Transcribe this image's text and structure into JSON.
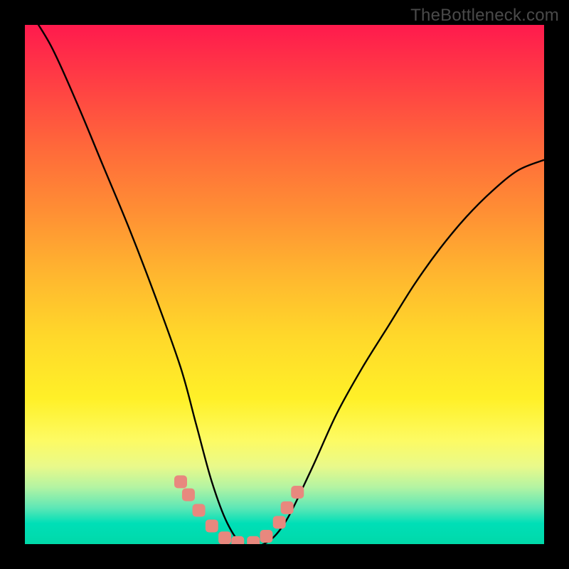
{
  "watermark": "TheBottleneck.com",
  "chart_data": {
    "type": "line",
    "title": "",
    "xlabel": "",
    "ylabel": "",
    "x": [
      0.0,
      0.05,
      0.1,
      0.15,
      0.2,
      0.25,
      0.3,
      0.33,
      0.36,
      0.39,
      0.42,
      0.46,
      0.5,
      0.55,
      0.6,
      0.65,
      0.7,
      0.75,
      0.8,
      0.85,
      0.9,
      0.95,
      1.0
    ],
    "values": [
      1.04,
      0.96,
      0.85,
      0.73,
      0.61,
      0.48,
      0.34,
      0.23,
      0.12,
      0.04,
      0.0,
      0.0,
      0.04,
      0.14,
      0.25,
      0.34,
      0.42,
      0.5,
      0.57,
      0.63,
      0.68,
      0.72,
      0.74
    ],
    "xlim": [
      0,
      1
    ],
    "ylim": [
      0,
      1
    ],
    "markers": {
      "color": "#e8887e",
      "points": [
        {
          "x": 0.3,
          "y": 0.12
        },
        {
          "x": 0.315,
          "y": 0.095
        },
        {
          "x": 0.335,
          "y": 0.065
        },
        {
          "x": 0.36,
          "y": 0.035
        },
        {
          "x": 0.385,
          "y": 0.012
        },
        {
          "x": 0.41,
          "y": 0.003
        },
        {
          "x": 0.44,
          "y": 0.003
        },
        {
          "x": 0.465,
          "y": 0.015
        },
        {
          "x": 0.49,
          "y": 0.042
        },
        {
          "x": 0.505,
          "y": 0.07
        },
        {
          "x": 0.525,
          "y": 0.1
        }
      ]
    }
  }
}
